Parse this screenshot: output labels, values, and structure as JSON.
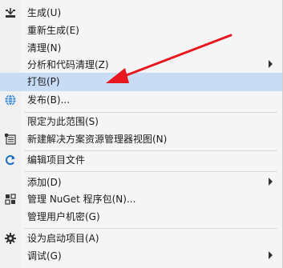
{
  "menu": {
    "items": [
      {
        "label": "生成(U)",
        "icon": "build-icon"
      },
      {
        "label": "重新生成(E)"
      },
      {
        "label": "清理(N)"
      },
      {
        "label": "分析和代码清理(Z)",
        "submenu": true
      },
      {
        "label": "打包(P)",
        "highlighted": true
      },
      {
        "label": "发布(B)...",
        "icon": "globe-icon"
      },
      {
        "label": "限定为此范围(S)"
      },
      {
        "label": "新建解决方案资源管理器视图(N)",
        "icon": "new-view-icon"
      },
      {
        "label": "编辑项目文件",
        "icon": "edit-refresh-icon"
      },
      {
        "label": "添加(D)",
        "submenu": true
      },
      {
        "label": "管理 NuGet 程序包(N)...",
        "icon": "nuget-icon"
      },
      {
        "label": "管理用户机密(G)"
      },
      {
        "label": "设为启动项目(A)",
        "icon": "gear-icon"
      },
      {
        "label": "调试(G)",
        "submenu": true
      }
    ]
  },
  "colors": {
    "highlight": "#c9dcf5",
    "annotation_arrow": "#e8161e"
  }
}
